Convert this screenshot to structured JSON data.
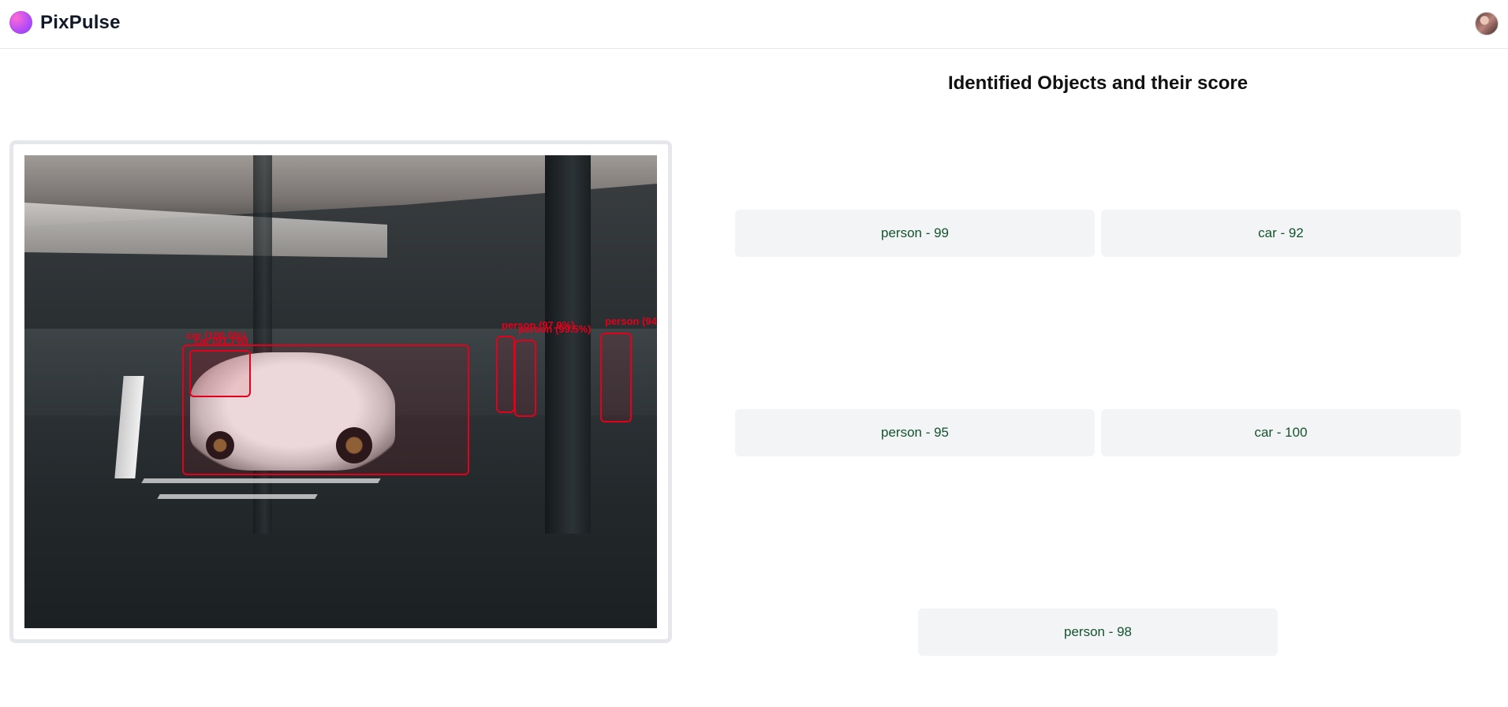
{
  "header": {
    "app_name": "PixPulse",
    "logo_icon": "gradient-circle-logo",
    "avatar_icon": "user-avatar"
  },
  "image_panel": {
    "detections": [
      {
        "label": "car (100.0%)"
      },
      {
        "label": "car (91.7%)"
      },
      {
        "label": "person (97.9%)"
      },
      {
        "label": "person (99.5%)"
      },
      {
        "label": "person (94"
      }
    ]
  },
  "results": {
    "title": "Identified Objects and their score",
    "items": [
      {
        "label": "person - 99"
      },
      {
        "label": "car - 92"
      },
      {
        "label": "person - 95"
      },
      {
        "label": "car - 100"
      },
      {
        "label": "person - 98"
      }
    ]
  },
  "colors": {
    "detection": "#e3001b",
    "card_background": "#f3f4f6",
    "card_text": "#14532d"
  }
}
